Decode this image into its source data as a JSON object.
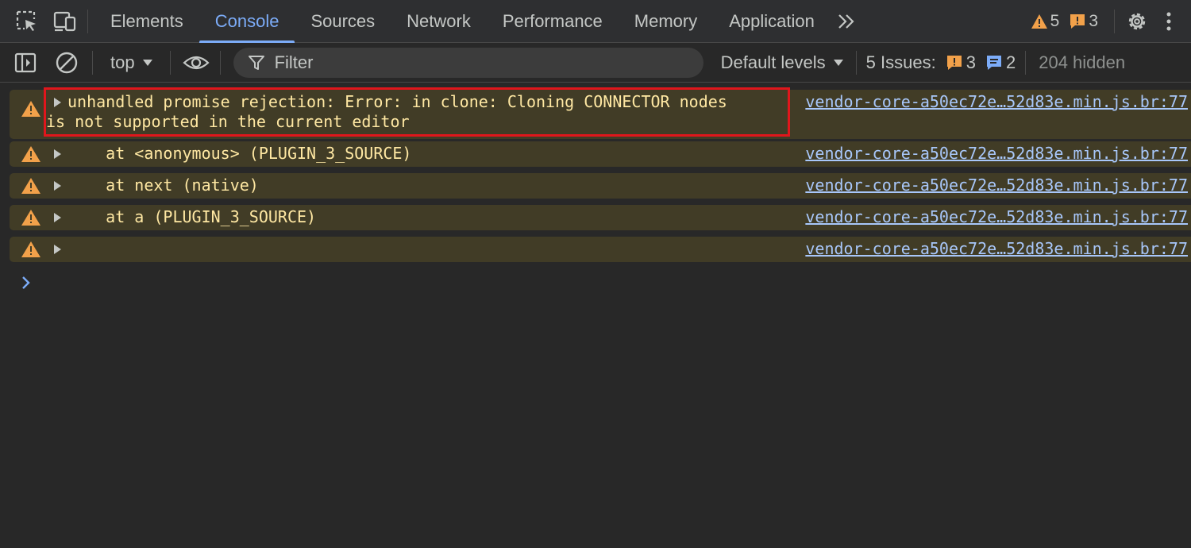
{
  "tabs": [
    {
      "label": "Elements",
      "active": false
    },
    {
      "label": "Console",
      "active": true
    },
    {
      "label": "Sources",
      "active": false
    },
    {
      "label": "Network",
      "active": false
    },
    {
      "label": "Performance",
      "active": false
    },
    {
      "label": "Memory",
      "active": false
    },
    {
      "label": "Application",
      "active": false
    }
  ],
  "tabbar": {
    "warning_count": "5",
    "error_count": "3"
  },
  "toolbar": {
    "context": "top",
    "filter_placeholder": "Filter",
    "levels": "Default levels",
    "issues_label": "5 Issues:",
    "issues_errors": "3",
    "issues_info": "2",
    "hidden": "204 hidden"
  },
  "messages": [
    {
      "line1": "unhandled promise rejection: Error: in clone: Cloning CONNECTOR nodes",
      "line2": "is not supported in the current editor",
      "source": "vendor-core-a50ec72e…52d83e.min.js.br:77"
    },
    {
      "text": "    at <anonymous> (PLUGIN_3_SOURCE)",
      "source": "vendor-core-a50ec72e…52d83e.min.js.br:77"
    },
    {
      "text": "    at next (native)",
      "source": "vendor-core-a50ec72e…52d83e.min.js.br:77"
    },
    {
      "text": "    at a (PLUGIN_3_SOURCE)",
      "source": "vendor-core-a50ec72e…52d83e.min.js.br:77"
    },
    {
      "text": "",
      "source": "vendor-core-a50ec72e…52d83e.min.js.br:77"
    }
  ],
  "colors": {
    "accent": "#7cacf8",
    "warning_bg": "#413c26",
    "warning_text": "#ffe8a3",
    "warning_icon": "#f2a14a",
    "link": "#a8c7fa",
    "highlight": "#e0161c"
  },
  "icons": {
    "inspect": "inspect-element-icon",
    "device": "device-toolbar-icon",
    "more_tabs": "chevron-double-right-icon",
    "settings": "gear-icon",
    "kebab": "more-vertical-icon",
    "sidebar": "sidebar-toggle-icon",
    "clear": "clear-console-icon",
    "eye": "eye-icon",
    "filter": "funnel-icon"
  }
}
